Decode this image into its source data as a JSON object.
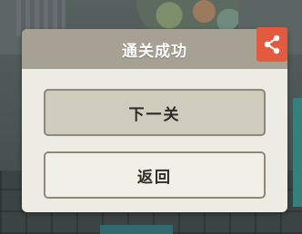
{
  "dialog": {
    "title": "通关成功",
    "share_icon": "share-icon",
    "buttons": {
      "next": "下一关",
      "back": "返回"
    }
  },
  "colors": {
    "header": "#a6a192",
    "panel": "#ecebe4",
    "share": "#e25a3f",
    "primary_button": "#cfcbbd",
    "secondary_button": "#f0efe8"
  }
}
